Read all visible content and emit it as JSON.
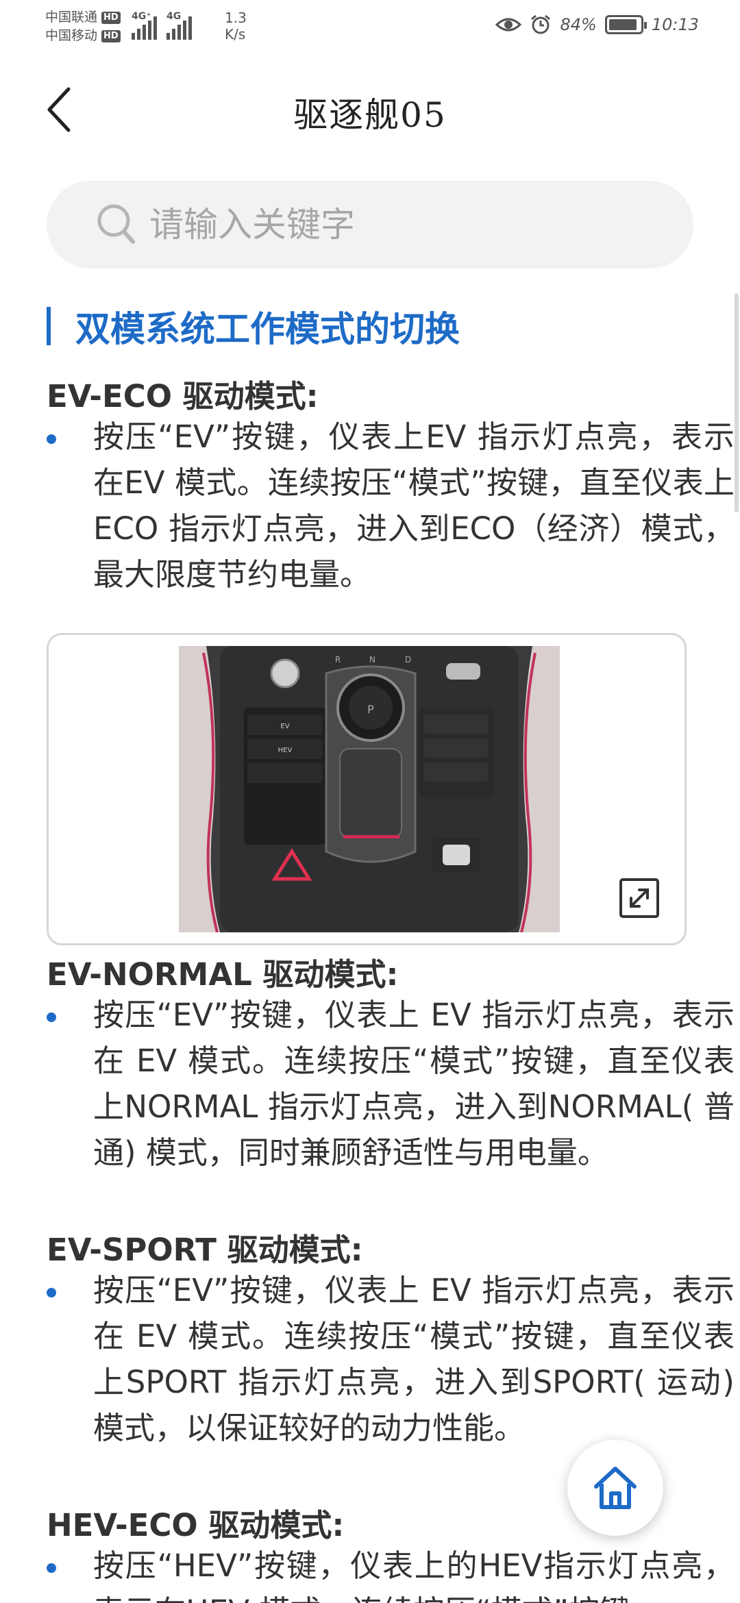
{
  "status_bar": {
    "carrier1": "中国联通",
    "carrier2": "中国移动",
    "hd": "HD",
    "net1": "4G⁺",
    "net2": "4G",
    "speed_value": "1.3",
    "speed_unit": "K/s",
    "battery": "84%",
    "time": "10:13"
  },
  "header": {
    "title": "驱逐舰05"
  },
  "search": {
    "placeholder": "请输入关键字"
  },
  "content": {
    "section_title": "双模系统工作模式的切换",
    "modes": [
      {
        "title": "EV-ECO 驱动模式:",
        "text": "按压“EV”按键，仪表上EV 指示灯点亮，表示在EV 模式。连续按压“模式”按键，直至仪表上ECO 指示灯点亮，进入到ECO（经济）模式，最大限度节约电量。"
      },
      {
        "title": "EV-NORMAL 驱动模式:",
        "text": "按压“EV”按键，仪表上 EV 指示灯点亮，表示在 EV 模式。连续按压“模式”按键，直至仪表上NORMAL 指示灯点亮，进入到NORMAL( 普通) 模式，同时兼顾舒适性与用电量。"
      },
      {
        "title": "EV-SPORT 驱动模式:",
        "text": "按压“EV”按键，仪表上 EV 指示灯点亮，表示在 EV 模式。连续按压“模式”按键，直至仪表上SPORT 指示灯点亮，进入到SPORT( 运动) 模式，以保证较好的动力性能。"
      },
      {
        "title": "HEV-ECO 驱动模式:",
        "text": "按压“HEV”按键，仪表上的HEV指示灯点亮，表示在HEV 模式。连续按压“模式”按键，"
      }
    ],
    "photo_labels": {
      "gear_r": "R",
      "gear_n": "N",
      "gear_d": "D",
      "gear_p": "P",
      "btn_ev": "EV",
      "btn_hev": "HEV"
    }
  },
  "icons": {
    "back": "chevron-left-icon",
    "search": "search-icon",
    "expand": "expand-icon",
    "home": "home-icon"
  },
  "colors": {
    "accent": "#1e6bc7",
    "search_bg": "#f2f2f2"
  }
}
